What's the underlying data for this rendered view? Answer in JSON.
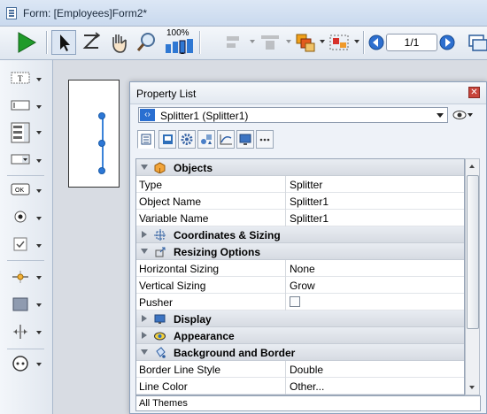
{
  "window": {
    "title": "Form: [Employees]Form2*"
  },
  "toolbar": {
    "zoom_label": "100%",
    "page_indicator": "1/1",
    "items": [
      "run-form",
      "select-arrow",
      "entry-order",
      "hand-tool",
      "zoom-tool",
      "view-zoom",
      "alignment",
      "distribution",
      "level",
      "grouping",
      "previous-page",
      "next-page",
      "windows"
    ]
  },
  "palette": {
    "items": [
      "text",
      "field",
      "list",
      "combo",
      "button",
      "radio",
      "checkbox",
      "splitter-h",
      "rectangle",
      "splitter-v",
      "plugin"
    ]
  },
  "property_list": {
    "title": "Property List",
    "selected_object": "Splitter1 (Splitter1)",
    "sections": [
      {
        "name": "Objects",
        "expanded": true,
        "rows": [
          {
            "key": "Type",
            "value": "Splitter"
          },
          {
            "key": "Object Name",
            "value": "Splitter1"
          },
          {
            "key": "Variable Name",
            "value": "Splitter1"
          }
        ]
      },
      {
        "name": "Coordinates & Sizing",
        "expanded": false,
        "rows": []
      },
      {
        "name": "Resizing Options",
        "expanded": true,
        "rows": [
          {
            "key": "Horizontal Sizing",
            "value": "None"
          },
          {
            "key": "Vertical Sizing",
            "value": "Grow"
          },
          {
            "key": "Pusher",
            "value": "",
            "checkbox": false
          }
        ]
      },
      {
        "name": "Display",
        "expanded": false,
        "rows": []
      },
      {
        "name": "Appearance",
        "expanded": false,
        "rows": []
      },
      {
        "name": "Background and Border",
        "expanded": true,
        "rows": [
          {
            "key": "Border Line Style",
            "value": "Double"
          },
          {
            "key": "Line Color",
            "value": "Other..."
          }
        ]
      }
    ],
    "footer": "All Themes"
  }
}
